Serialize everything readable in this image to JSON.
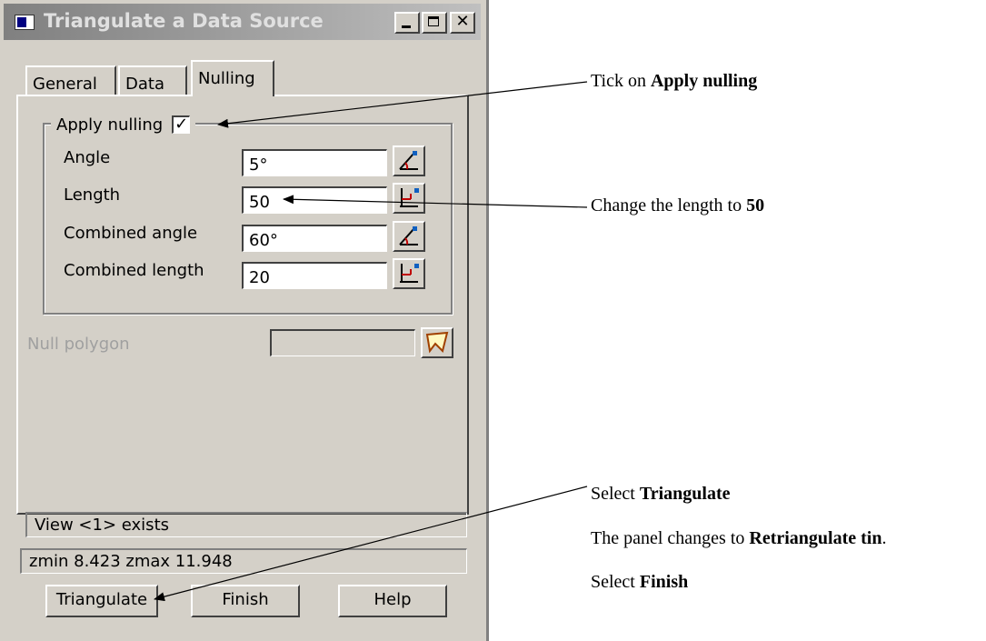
{
  "window": {
    "title": "Triangulate a Data Source",
    "controls": {
      "minimize": "_",
      "maximize": "□",
      "close": "✕"
    }
  },
  "tabs": [
    {
      "label": "General"
    },
    {
      "label": "Data"
    },
    {
      "label": "Nulling",
      "active": true
    }
  ],
  "nulling": {
    "apply_label": "Apply nulling",
    "apply_checked": true,
    "checkmark": "✓",
    "rows": [
      {
        "label": "Angle",
        "value": "5°",
        "icon": "angle-pick-icon"
      },
      {
        "label": "Length",
        "value": "50",
        "icon": "length-pick-icon"
      },
      {
        "label": "Combined angle",
        "value": "60°",
        "icon": "angle-pick-icon"
      },
      {
        "label": "Combined length",
        "value": "20",
        "icon": "length-pick-icon"
      }
    ],
    "null_polygon_label": "Null polygon",
    "null_polygon_value": ""
  },
  "status": {
    "message1": "View <1> exists",
    "message2": "zmin 8.423 zmax 11.948"
  },
  "buttons": {
    "triangulate": "Triangulate",
    "finish": "Finish",
    "help": "Help"
  },
  "annotations": {
    "a1_prefix": "Tick on ",
    "a1_bold": "Apply nulling",
    "a2_prefix": "Change the length to ",
    "a2_bold": "50",
    "a3_prefix": "Select ",
    "a3_bold": "Triangulate",
    "a4_prefix": "The panel changes to ",
    "a4_bold": "Retriangulate tin",
    "a4_suffix": ".",
    "a5_prefix": "Select ",
    "a5_bold": "Finish"
  },
  "colors": {
    "dialog_bg": "#d4d0c8",
    "titlebar_gradient_start": "#808080",
    "disabled_text": "#a0a0a0",
    "field_bg": "#ffffff"
  }
}
